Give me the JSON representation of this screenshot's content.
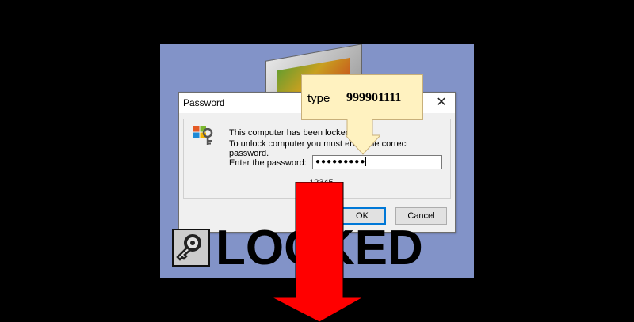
{
  "dialog": {
    "title": "Password",
    "message_line1": "This computer has been locked.",
    "message_line2": "To unlock computer you must enter the correct password.",
    "password_label": "Enter the password:",
    "password_masked": "●●●●●●●●●",
    "hint_number": "12345",
    "ok_label": "OK",
    "cancel_label": "Cancel"
  },
  "banner": {
    "text": "LOCKED"
  },
  "callout": {
    "word": "type",
    "code": "999901111"
  },
  "colors": {
    "background": "#000000",
    "panel": "#8293c8",
    "arrow": "#ff0000",
    "callout": "#fff2c0",
    "button_focus": "#0078d7"
  }
}
